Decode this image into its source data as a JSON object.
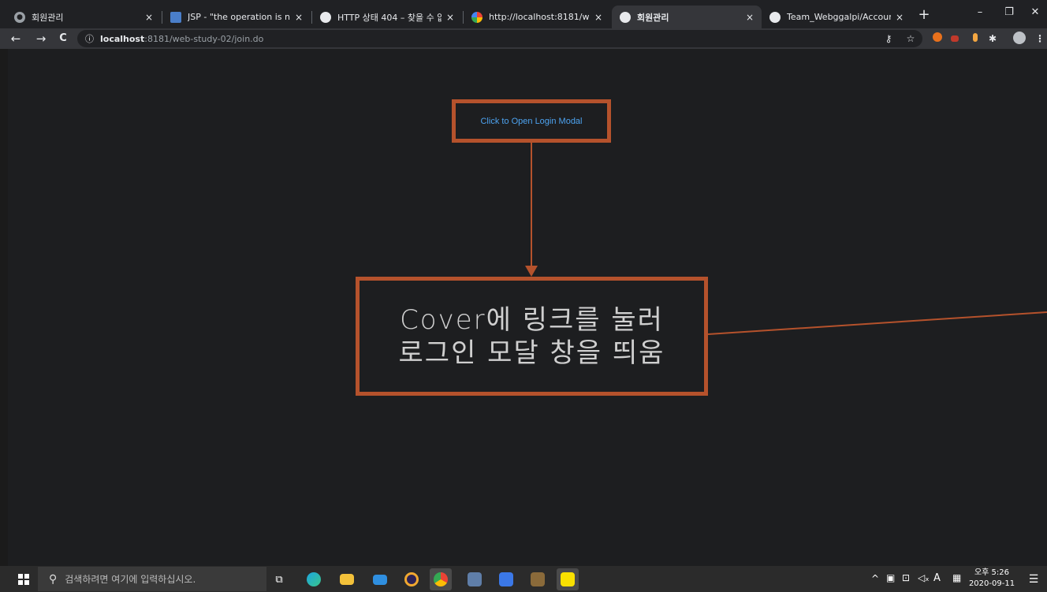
{
  "browser": {
    "tabs": [
      {
        "title": "회원관리",
        "close": "×",
        "active": false
      },
      {
        "title": "JSP - \"the operation is not ap",
        "close": "×",
        "active": false
      },
      {
        "title": "HTTP 상태 404 – 찾을 수 없음",
        "close": "×",
        "active": false
      },
      {
        "title": "http://localhost:8181/web-stu",
        "close": "×",
        "active": false
      },
      {
        "title": "회원관리",
        "close": "×",
        "active": true
      },
      {
        "title": "Team_Webggalpi/AccountVO",
        "close": "×",
        "active": false
      }
    ],
    "new_tab": "+",
    "window_controls": {
      "minimize": "–",
      "restore": "❐",
      "close": "✕"
    },
    "address": {
      "info": "ⓘ",
      "host": "localhost",
      "path": ":8181/web-study-02/join.do"
    },
    "nav": {
      "back": "←",
      "forward": "→",
      "reload": "C"
    }
  },
  "page": {
    "open_modal_link": "Click to Open Login Modal",
    "callout_line1": "Cover에 링크를 눌러",
    "callout_line2": "로그인 모달 창을 띄움"
  },
  "taskbar": {
    "search_placeholder": "검색하려면 여기에 입력하십시오.",
    "tray_chevron": "^",
    "ime_label": "A",
    "clock_time": "오후 5:26",
    "clock_date": "2020-09-11"
  },
  "colors": {
    "annotation": "#b5522c",
    "link": "#4da3f0"
  }
}
